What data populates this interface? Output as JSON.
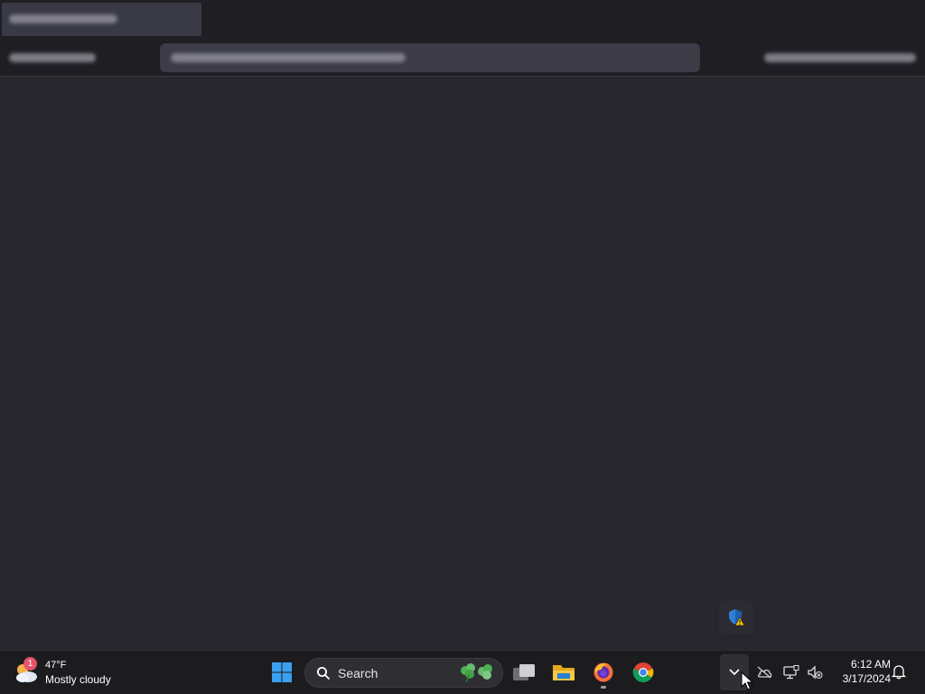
{
  "weather": {
    "temperature": "47°F",
    "condition": "Mostly cloudy",
    "badge_count": "1"
  },
  "search": {
    "label": "Search"
  },
  "clock": {
    "time": "6:12 AM",
    "date": "3/17/2024"
  },
  "taskbar_icons": [
    "start-icon",
    "search-icon",
    "task-view-icon",
    "file-explorer-icon",
    "firefox-icon",
    "chrome-icon"
  ],
  "tray_icons": [
    "chevron-up-icon",
    "onedrive-icon",
    "network-icon",
    "volume-muted-icon",
    "notification-bell-icon"
  ],
  "colors": {
    "background": "#28272e",
    "taskbar": "#1c1c1f",
    "accent_blue": "#3aa0f0"
  }
}
